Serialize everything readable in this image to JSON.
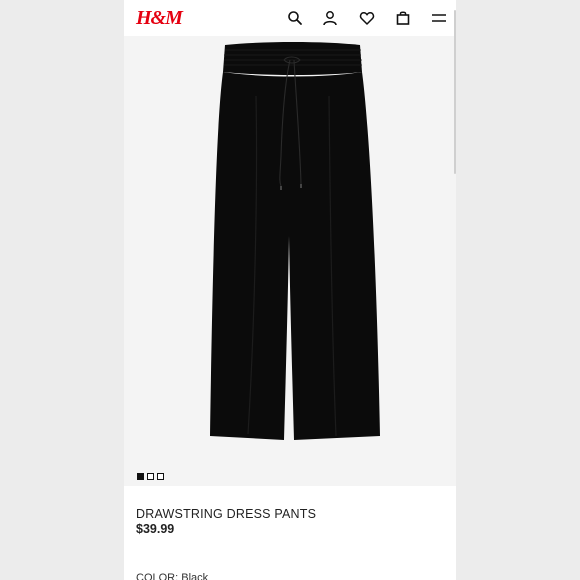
{
  "header": {
    "logo": "H&M",
    "icons": [
      "search-icon",
      "account-icon",
      "favorites-icon",
      "bag-icon",
      "menu-icon"
    ]
  },
  "gallery": {
    "image_count": 3,
    "active_index": 0
  },
  "product": {
    "title": "DRAWSTRING DRESS PANTS",
    "price": "$39.99",
    "color_label": "COLOR:",
    "color_value": "Black"
  },
  "colors": {
    "brand": "#e50010",
    "product": "#0b0b0b",
    "background": "#ececec"
  }
}
